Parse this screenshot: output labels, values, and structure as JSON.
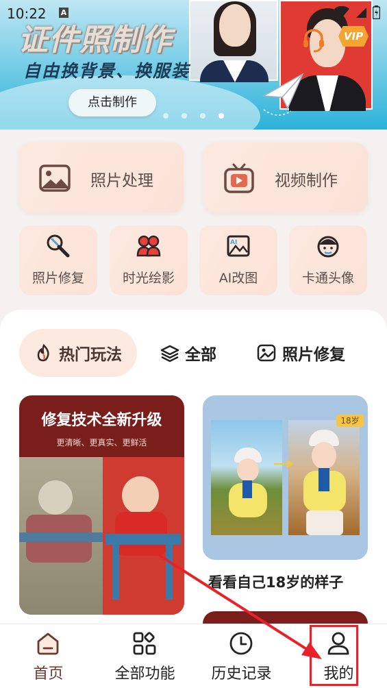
{
  "status_bar": {
    "time": "10:22",
    "a_badge": "A"
  },
  "banner": {
    "title": "证件照制作",
    "subtitle": "自由换背景、换服装",
    "button": "点击制作",
    "vip": "VIP",
    "dots": 4,
    "active_dot": 3
  },
  "tools": {
    "big": [
      {
        "label": "照片处理",
        "icon": "photo-icon"
      },
      {
        "label": "视频制作",
        "icon": "tv-icon"
      }
    ],
    "small": [
      {
        "label": "照片修复",
        "icon": "wrench-icon"
      },
      {
        "label": "时光绘影",
        "icon": "people-icon"
      },
      {
        "label": "AI改图",
        "icon": "ai-image-icon"
      },
      {
        "label": "卡通头像",
        "icon": "cartoon-face-icon"
      }
    ]
  },
  "tabs": [
    {
      "label": "热门玩法",
      "icon": "flame-icon",
      "active": true
    },
    {
      "label": "全部",
      "icon": "layers-icon",
      "active": false
    },
    {
      "label": "照片修复",
      "icon": "image-edit-icon",
      "active": false
    }
  ],
  "cards": [
    {
      "headline": "修复技术全新升级",
      "subline": "更清晰、更真实、更鲜活"
    },
    {
      "tag": "18岁",
      "title": "看看自己18岁的样子"
    }
  ],
  "bottom_nav": [
    {
      "label": "首页",
      "icon": "home-icon",
      "active": true
    },
    {
      "label": "全部功能",
      "icon": "grid-icon",
      "active": false
    },
    {
      "label": "历史记录",
      "icon": "clock-icon",
      "active": false
    },
    {
      "label": "我的",
      "icon": "user-icon",
      "active": false
    }
  ],
  "colors": {
    "accent": "#6b3a2f",
    "card_bg": "#fce9df",
    "annotation": "#e8212a"
  }
}
